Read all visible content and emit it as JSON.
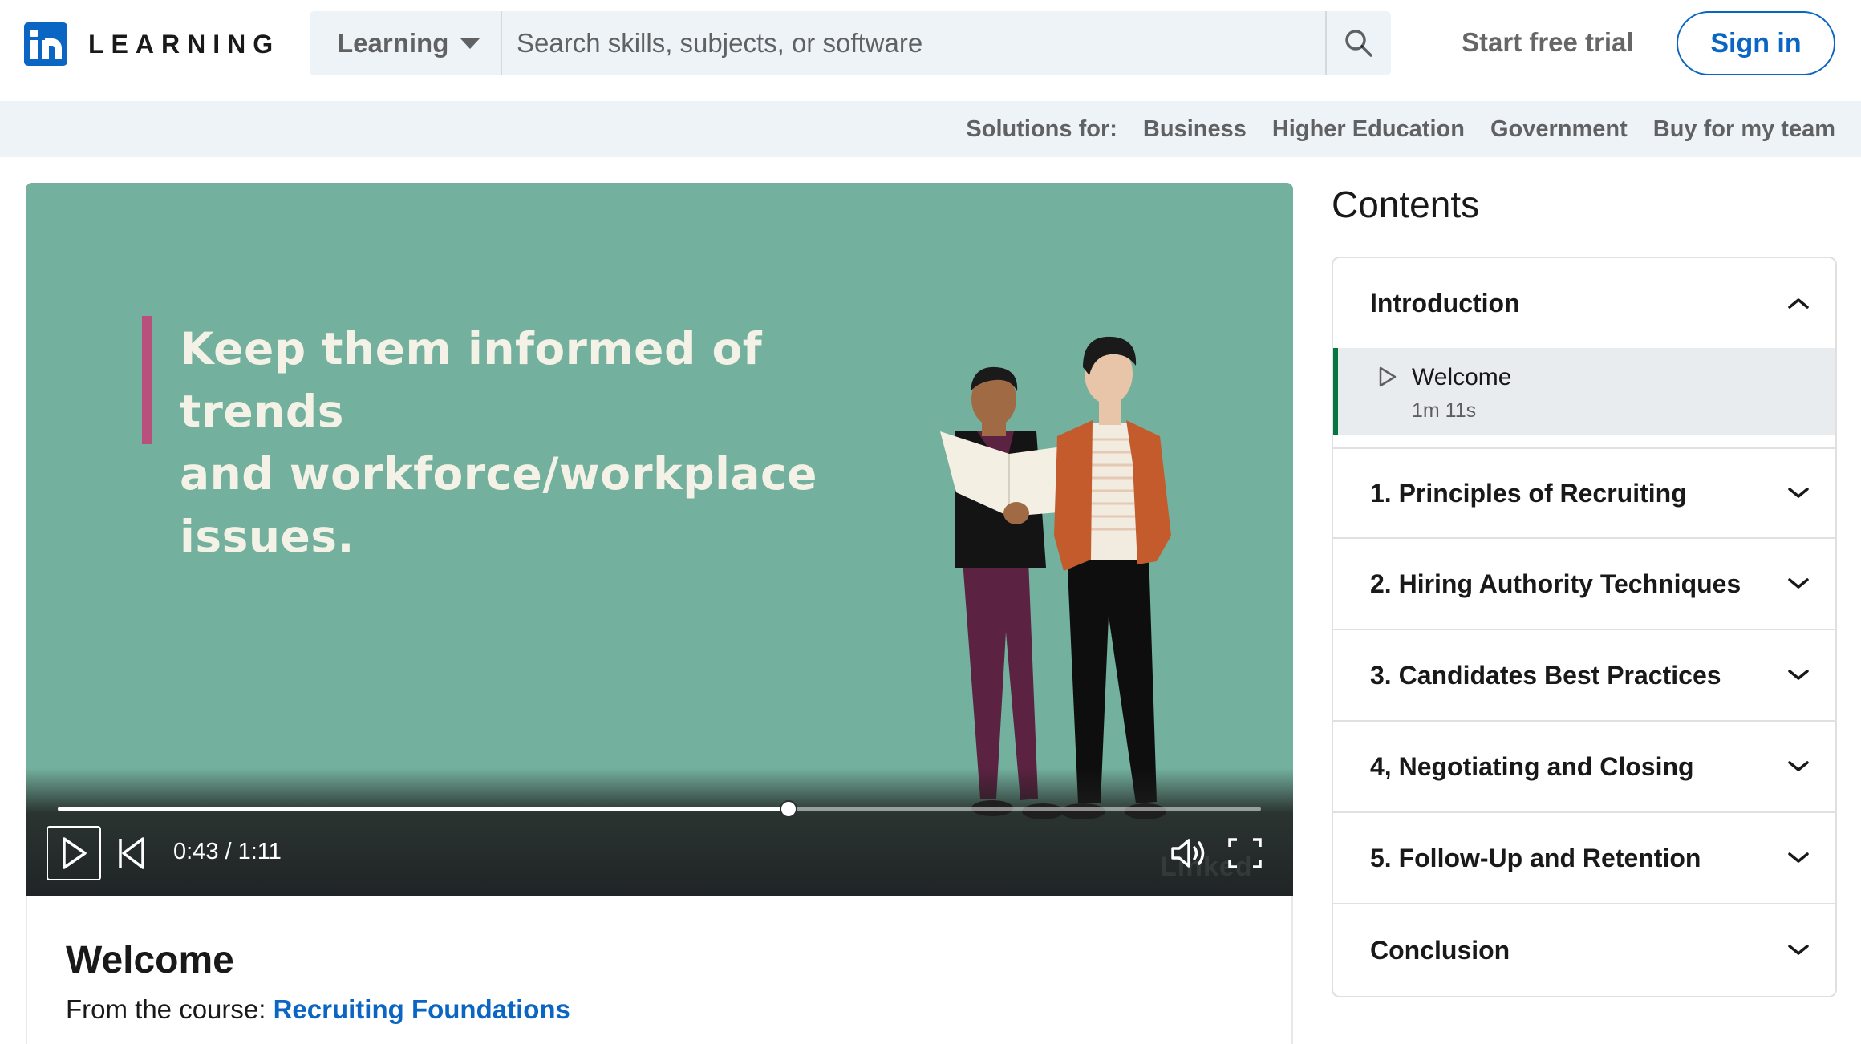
{
  "header": {
    "logo_text": "LEARNING",
    "search_category": "Learning",
    "search_placeholder": "Search skills, subjects, or software",
    "start_free_trial": "Start free trial",
    "sign_in": "Sign in"
  },
  "subnav": {
    "solutions_label": "Solutions for:",
    "links": [
      "Business",
      "Higher Education",
      "Government",
      "Buy for my team"
    ]
  },
  "video": {
    "slide_line1": "Keep them informed of trends",
    "slide_line2": "and workforce/workplace issues.",
    "time": "0:43 / 1:11",
    "progress": 0.607,
    "watermark": "Linked",
    "colors": {
      "background": "#73b09d",
      "accent_bar": "#b84f7d"
    }
  },
  "video_info": {
    "title": "Welcome",
    "course_prefix": "From the course: ",
    "course_name": "Recruiting Foundations"
  },
  "contents": {
    "title": "Contents",
    "sections": [
      {
        "label": "Introduction",
        "expanded": true,
        "items": [
          {
            "title": "Welcome",
            "duration": "1m 11s",
            "active": true
          }
        ]
      },
      {
        "label": "1. Principles of Recruiting",
        "expanded": false
      },
      {
        "label": "2. Hiring Authority Techniques",
        "expanded": false
      },
      {
        "label": "3. Candidates Best Practices",
        "expanded": false
      },
      {
        "label": "4, Negotiating and Closing",
        "expanded": false
      },
      {
        "label": "5. Follow-Up and Retention",
        "expanded": false
      },
      {
        "label": "Conclusion",
        "expanded": false
      }
    ]
  },
  "colors": {
    "brand": "#0a66c2",
    "active_marker": "#057642"
  }
}
